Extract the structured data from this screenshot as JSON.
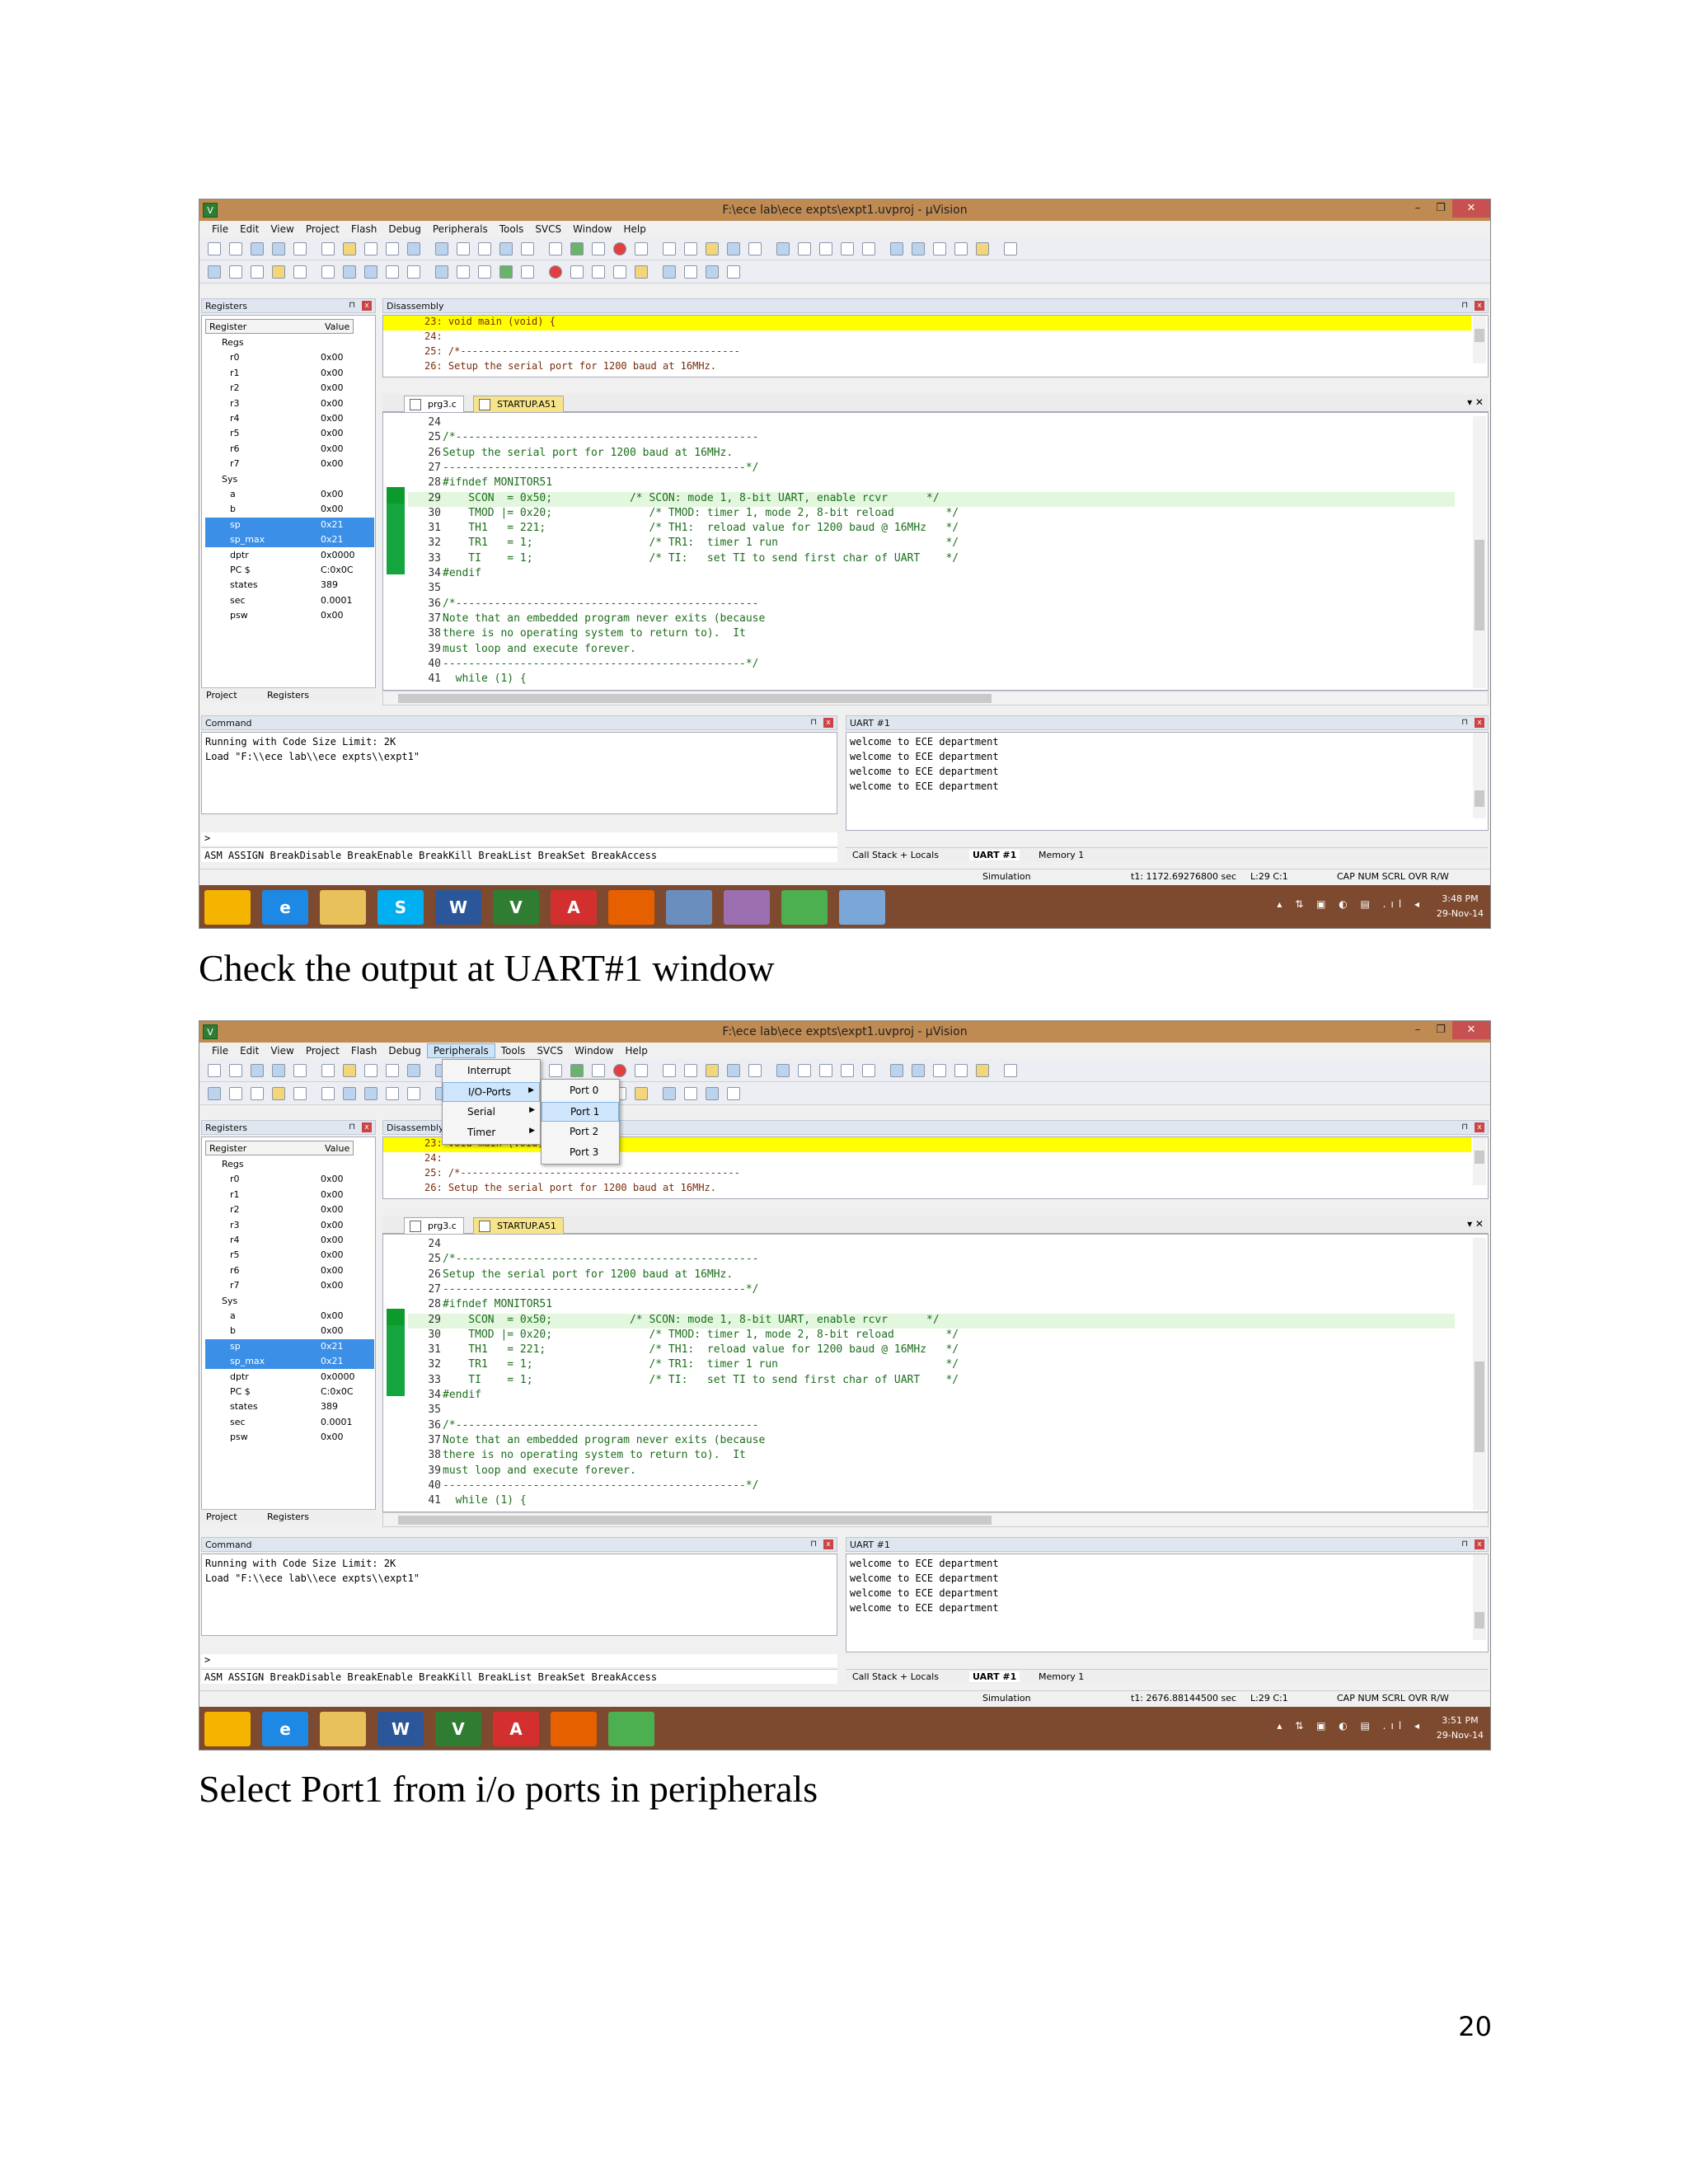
{
  "window": {
    "title": "F:\\ece lab\\ece expts\\expt1.uvproj - µVision",
    "app_icon": "V",
    "minimize": "–",
    "restore": "❐",
    "close": "✕"
  },
  "menu": [
    "File",
    "Edit",
    "View",
    "Project",
    "Flash",
    "Debug",
    "Peripherals",
    "Tools",
    "SVCS",
    "Window",
    "Help"
  ],
  "registers_panel": {
    "title": "Registers",
    "col_register": "Register",
    "col_value": "Value",
    "rows": [
      {
        "name": "Regs",
        "value": "",
        "group": true
      },
      {
        "name": "r0",
        "value": "0x00"
      },
      {
        "name": "r1",
        "value": "0x00"
      },
      {
        "name": "r2",
        "value": "0x00"
      },
      {
        "name": "r3",
        "value": "0x00"
      },
      {
        "name": "r4",
        "value": "0x00"
      },
      {
        "name": "r5",
        "value": "0x00"
      },
      {
        "name": "r6",
        "value": "0x00"
      },
      {
        "name": "r7",
        "value": "0x00"
      },
      {
        "name": "Sys",
        "value": "",
        "group": true
      },
      {
        "name": "a",
        "value": "0x00"
      },
      {
        "name": "b",
        "value": "0x00"
      },
      {
        "name": "sp",
        "value": "0x21",
        "selected": true
      },
      {
        "name": "sp_max",
        "value": "0x21",
        "selected": true
      },
      {
        "name": "dptr",
        "value": "0x0000"
      },
      {
        "name": "PC $",
        "value": "C:0x0C"
      },
      {
        "name": "states",
        "value": "389"
      },
      {
        "name": "sec",
        "value": "0.0001"
      },
      {
        "name": "psw",
        "value": "0x00"
      }
    ],
    "tab_project": "Project",
    "tab_registers": "Registers"
  },
  "disassembly": {
    "title": "Disassembly",
    "lines": [
      {
        "text": "23: void main (void) {",
        "current": true
      },
      {
        "text": "24:"
      },
      {
        "text": "25: /*-----------------------------------------------"
      },
      {
        "text": "26: Setup the serial port for 1200 baud at 16MHz."
      }
    ]
  },
  "editor": {
    "tab_active": "prg3.c",
    "tab_other": "STARTUP.A51",
    "lines": [
      {
        "ln": "24",
        "code": ""
      },
      {
        "ln": "25",
        "code": "/*-----------------------------------------------"
      },
      {
        "ln": "26",
        "code": "Setup the serial port for 1200 baud at 16MHz."
      },
      {
        "ln": "27",
        "code": "-----------------------------------------------*/"
      },
      {
        "ln": "28",
        "code": "#ifndef MONITOR51"
      },
      {
        "ln": "29",
        "code": "    SCON  = 0x50;            /* SCON: mode 1, 8-bit UART, enable rcvr      */",
        "hl": true
      },
      {
        "ln": "30",
        "code": "    TMOD |= 0x20;               /* TMOD: timer 1, mode 2, 8-bit reload        */"
      },
      {
        "ln": "31",
        "code": "    TH1   = 221;                /* TH1:  reload value for 1200 baud @ 16MHz   */"
      },
      {
        "ln": "32",
        "code": "    TR1   = 1;                  /* TR1:  timer 1 run                          */"
      },
      {
        "ln": "33",
        "code": "    TI    = 1;                  /* TI:   set TI to send first char of UART    */"
      },
      {
        "ln": "34",
        "code": "#endif"
      },
      {
        "ln": "35",
        "code": ""
      },
      {
        "ln": "36",
        "code": "/*-----------------------------------------------"
      },
      {
        "ln": "37",
        "code": "Note that an embedded program never exits (because"
      },
      {
        "ln": "38",
        "code": "there is no operating system to return to).  It"
      },
      {
        "ln": "39",
        "code": "must loop and execute forever."
      },
      {
        "ln": "40",
        "code": "-----------------------------------------------*/"
      },
      {
        "ln": "41",
        "code": "  while (1) {"
      }
    ]
  },
  "command": {
    "title": "Command",
    "lines": [
      "Running with Code Size Limit: 2K",
      "Load \"F:\\\\ece lab\\\\ece expts\\\\expt1\""
    ],
    "prompt": ">",
    "hints": "ASM ASSIGN BreakDisable BreakEnable BreakKill BreakList BreakSet BreakAccess"
  },
  "uart": {
    "title": "UART #1",
    "lines": [
      "welcome to ECE department",
      "welcome to ECE department",
      "welcome to ECE department",
      "welcome to ECE department"
    ],
    "tab_callstack": "Call Stack + Locals",
    "tab_uart": "UART #1",
    "tab_memory": "Memory 1"
  },
  "status": {
    "mode": "Simulation",
    "pos": "L:29 C:1",
    "keys": "CAP  NUM  SCRL  OVR  R/W",
    "shot1_t1": "t1: 1172.69276800 sec",
    "shot2_t1": "t1: 2676.88144500 sec"
  },
  "taskbar": {
    "shot1_time": "3:48 PM",
    "shot2_time": "3:51 PM",
    "date": "29-Nov-14",
    "tray": "▴ ⇅ ▣ ◐ ▤ .ıl ◂",
    "shot1_apps": [
      {
        "icon": "start-icon",
        "label": "",
        "color": "#f4b400"
      },
      {
        "icon": "ie-icon",
        "label": "e",
        "color": "#1e88e5"
      },
      {
        "icon": "folder-icon",
        "label": "",
        "color": "#e8c15a"
      },
      {
        "icon": "skype-icon",
        "label": "S",
        "color": "#00aff0"
      },
      {
        "icon": "word-icon",
        "label": "W",
        "color": "#2b579a"
      },
      {
        "icon": "uvision-icon",
        "label": "V",
        "color": "#2e7d32"
      },
      {
        "icon": "acrobat-icon",
        "label": "A",
        "color": "#d32f2f"
      },
      {
        "icon": "firefox-icon",
        "label": "",
        "color": "#e66000"
      },
      {
        "icon": "network-icon",
        "label": "",
        "color": "#6a8fbf"
      },
      {
        "icon": "tool-icon",
        "label": "",
        "color": "#9c6fb0"
      },
      {
        "icon": "chrome-icon",
        "label": "",
        "color": "#4caf50"
      },
      {
        "icon": "app-icon",
        "label": "",
        "color": "#7aa7d8"
      }
    ],
    "shot2_apps": [
      {
        "icon": "start-icon",
        "label": "",
        "color": "#f4b400"
      },
      {
        "icon": "ie-icon",
        "label": "e",
        "color": "#1e88e5"
      },
      {
        "icon": "folder-icon",
        "label": "",
        "color": "#e8c15a"
      },
      {
        "icon": "word-icon",
        "label": "W",
        "color": "#2b579a"
      },
      {
        "icon": "uvision-icon",
        "label": "V",
        "color": "#2e7d32"
      },
      {
        "icon": "acrobat-icon",
        "label": "A",
        "color": "#d32f2f"
      },
      {
        "icon": "firefox-icon",
        "label": "",
        "color": "#e66000"
      },
      {
        "icon": "chrome-icon",
        "label": "",
        "color": "#4caf50"
      }
    ]
  },
  "peripherals_menu": {
    "items": [
      "Interrupt",
      "I/O-Ports",
      "Serial",
      "Timer"
    ],
    "ports": [
      "Port 0",
      "Port 1",
      "Port 2",
      "Port 3"
    ]
  },
  "caption1": "Check the output at UART#1 window",
  "caption2": "Select Port1 from i/o ports in peripherals",
  "page_number": "20"
}
